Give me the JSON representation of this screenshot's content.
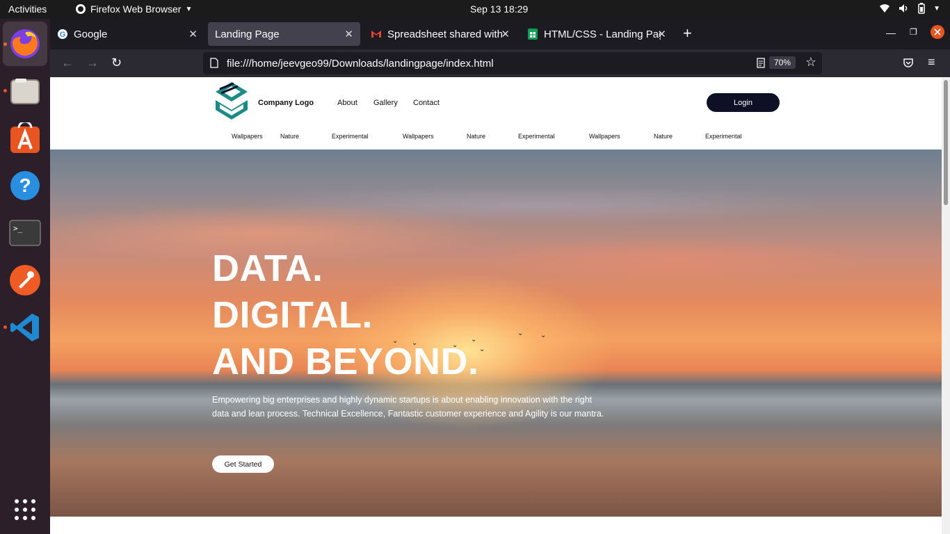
{
  "topbar": {
    "activities": "Activities",
    "app_name": "Firefox Web Browser",
    "clock": "Sep 13  18:29"
  },
  "dock": {
    "items": [
      "firefox-icon",
      "files-icon",
      "software-store-icon",
      "help-icon",
      "terminal-icon",
      "postman-icon",
      "vscode-icon"
    ],
    "show_apps_icon": "app-grid-icon"
  },
  "browser": {
    "tabs": [
      {
        "title": "Google",
        "active": false
      },
      {
        "title": "Landing Page",
        "active": true
      },
      {
        "title": "Spreadsheet shared with",
        "active": false
      },
      {
        "title": "HTML/CSS - Landing Page",
        "active": false
      }
    ],
    "url": "file:///home/jeevgeo99/Downloads/landingpage/index.html",
    "zoom": "70%"
  },
  "site": {
    "logo_text": "Company Logo",
    "nav": [
      "About",
      "Gallery",
      "Contact"
    ],
    "login_label": "Login",
    "subnav": [
      "Wallpapers",
      "Nature",
      "Experimental",
      "Wallpapers",
      "Nature",
      "Experimental",
      "Wallpapers",
      "Nature",
      "Experimental"
    ],
    "hero": {
      "title_lines": [
        "DATA.",
        "DIGITAL.",
        "AND BEYOND."
      ],
      "text": "Empowering big enterprises and highly dynamic startups is about enabling innovation with the right data and lean process. Technical Excellence, Fantastic customer experience and Agility is our mantra.",
      "cta": "Get Started"
    }
  },
  "colors": {
    "accent_teal": "#1a8a8a",
    "login_bg": "#0e1025",
    "ubuntu_orange": "#e95420"
  }
}
